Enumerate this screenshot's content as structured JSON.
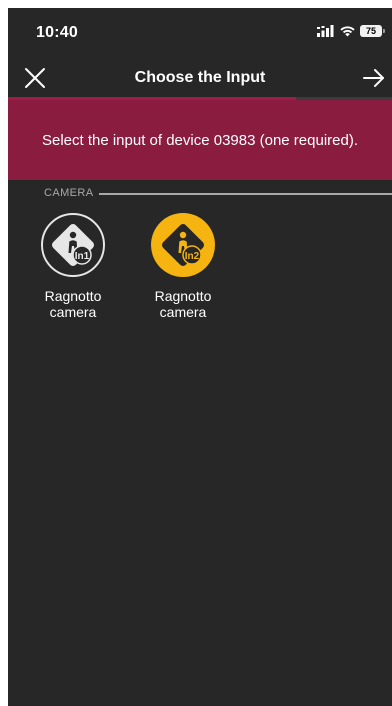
{
  "status_bar": {
    "time": "10:40",
    "signal_text": ":ııl",
    "battery": "75"
  },
  "nav": {
    "title": "Choose the Input",
    "close_icon": "close-icon",
    "next_icon": "arrow-right-icon",
    "progress": 0.75
  },
  "banner": {
    "text": "Select the input of device 03983 (one required)."
  },
  "section": {
    "label": "CAMERA"
  },
  "inputs": [
    {
      "label_line1": "Ragnotto",
      "label_line2": "camera",
      "badge": "In1",
      "selected": false
    },
    {
      "label_line1": "Ragnotto",
      "label_line2": "camera",
      "badge": "In2",
      "selected": true
    }
  ],
  "colors": {
    "background": "#272727",
    "banner": "#8a1c40",
    "accent": "#a01c49",
    "selected": "#f5b40f",
    "unselected": "#e6e6e6"
  }
}
